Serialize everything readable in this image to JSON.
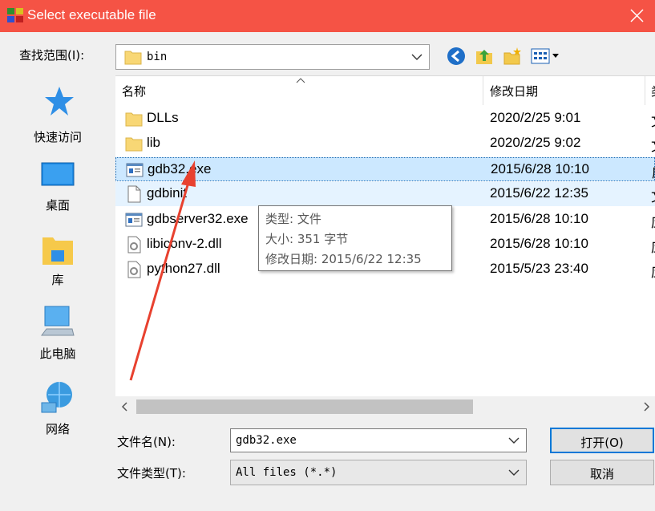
{
  "window": {
    "title": "Select executable file"
  },
  "toolbar": {
    "look_in_label": "查找范围(I):",
    "look_in_value": "bin"
  },
  "places": [
    {
      "label": "快速访问",
      "icon": "star-icon"
    },
    {
      "label": "桌面",
      "icon": "desktop-icon"
    },
    {
      "label": "库",
      "icon": "library-icon"
    },
    {
      "label": "此电脑",
      "icon": "computer-icon"
    },
    {
      "label": "网络",
      "icon": "network-icon"
    }
  ],
  "list": {
    "columns": {
      "name": "名称",
      "date": "修改日期",
      "extra": "类"
    },
    "rows": [
      {
        "name": "DLLs",
        "date": "2020/2/25 9:01",
        "extra": "文",
        "icon": "folder-icon",
        "state": ""
      },
      {
        "name": "lib",
        "date": "2020/2/25 9:02",
        "extra": "文",
        "icon": "folder-icon",
        "state": ""
      },
      {
        "name": "gdb32.exe",
        "date": "2015/6/28 10:10",
        "extra": "应",
        "icon": "exe-icon",
        "state": "selected"
      },
      {
        "name": "gdbinit",
        "date": "2015/6/22 12:35",
        "extra": "文",
        "icon": "file-icon",
        "state": "hover"
      },
      {
        "name": "gdbserver32.exe",
        "date": "2015/6/28 10:10",
        "extra": "应",
        "icon": "exe-icon",
        "state": ""
      },
      {
        "name": "libiconv-2.dll",
        "date": "2015/6/28 10:10",
        "extra": "应",
        "icon": "dll-icon",
        "state": ""
      },
      {
        "name": "python27.dll",
        "date": "2015/5/23 23:40",
        "extra": "应",
        "icon": "dll-icon",
        "state": ""
      }
    ]
  },
  "tooltip": {
    "type_line": "类型: 文件",
    "size_line": "大小: 351 字节",
    "date_line": "修改日期: 2015/6/22 12:35"
  },
  "footer": {
    "filename_label": "文件名(N):",
    "filename_value": "gdb32.exe",
    "filetype_label": "文件类型(T):",
    "filetype_value": "All files (*.*)",
    "open_label": "打开(O)",
    "cancel_label": "取消"
  },
  "colors": {
    "titlebar": "#f55345",
    "selection": "#cce8ff",
    "hover": "#e5f3ff",
    "annotation_arrow": "#e8412f"
  }
}
